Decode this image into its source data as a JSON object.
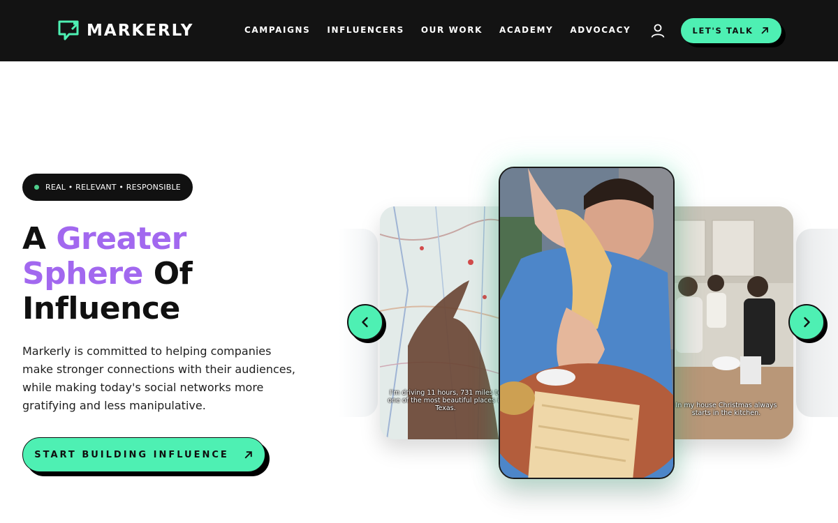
{
  "brand": {
    "name": "MARKERLY",
    "accent": "#4ef0b3",
    "purple": "#a268ef",
    "header_bg": "#131313"
  },
  "nav": {
    "items": [
      {
        "label": "CAMPAIGNS"
      },
      {
        "label": "INFLUENCERS"
      },
      {
        "label": "OUR WORK"
      },
      {
        "label": "ACADEMY"
      },
      {
        "label": "ADVOCACY"
      }
    ],
    "user_icon": "user-icon",
    "cta_label": "LET'S TALK",
    "cta_icon": "arrow-up-right-icon"
  },
  "hero": {
    "tagline": "REAL • RELEVANT • RESPONSIBLE",
    "headline": {
      "w1": "A",
      "w2": "Greater",
      "w3": "Sphere",
      "w4": "Of",
      "w5": "Influence"
    },
    "description": "Markerly is committed to helping companies make stronger connections with their audiences, while making today's social networks more gratifying and less manipulative.",
    "cta_label": "START BUILDING INFLUENCE",
    "cta_icon": "arrow-up-right-icon"
  },
  "carousel": {
    "prev_icon": "chevron-left-icon",
    "next_icon": "chevron-right-icon",
    "cards": [
      {
        "caption": "I'm driving 11 hours, 731 miles to one of the most beautiful places in Texas."
      },
      {
        "caption": ""
      },
      {
        "caption": "In my house Christmas always starts in the kitchen."
      }
    ]
  }
}
